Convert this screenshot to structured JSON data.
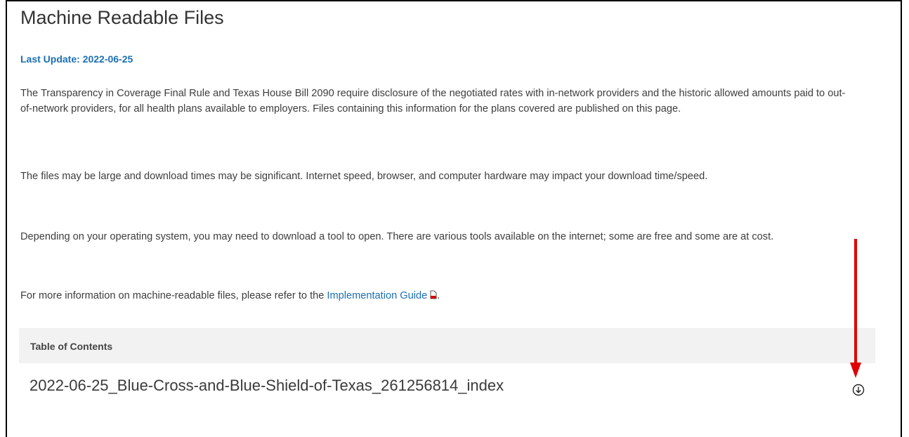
{
  "page": {
    "title": "Machine Readable Files",
    "last_update": "Last Update: 2022-06-25"
  },
  "paragraphs": {
    "p1": "The Transparency in Coverage Final Rule and Texas House Bill 2090 require disclosure of the negotiated rates with in-network providers and the historic allowed amounts paid to out-of-network providers, for all health plans available to employers.  Files containing this information for the plans covered are published on this page.",
    "p2": "The files may be large and download times may be significant. Internet speed, browser, and computer hardware may impact your download time/speed.",
    "p3": "Depending on your operating system, you may need to download a tool to open.  There are various tools available on the internet; some are free and some are at cost.",
    "p4_prefix": "For more information on machine-readable files, please refer to the ",
    "p4_link": "Implementation Guide",
    "p4_suffix": "."
  },
  "toc": {
    "header": "Table of Contents",
    "items": [
      {
        "label": "2022-06-25_Blue-Cross-and-Blue-Shield-of-Texas_261256814_index",
        "icon": "download-circle-icon"
      }
    ]
  },
  "colors": {
    "link": "#1b6fb5",
    "annotation_arrow": "#e00000",
    "toc_header_bg": "#f2f2f2"
  }
}
